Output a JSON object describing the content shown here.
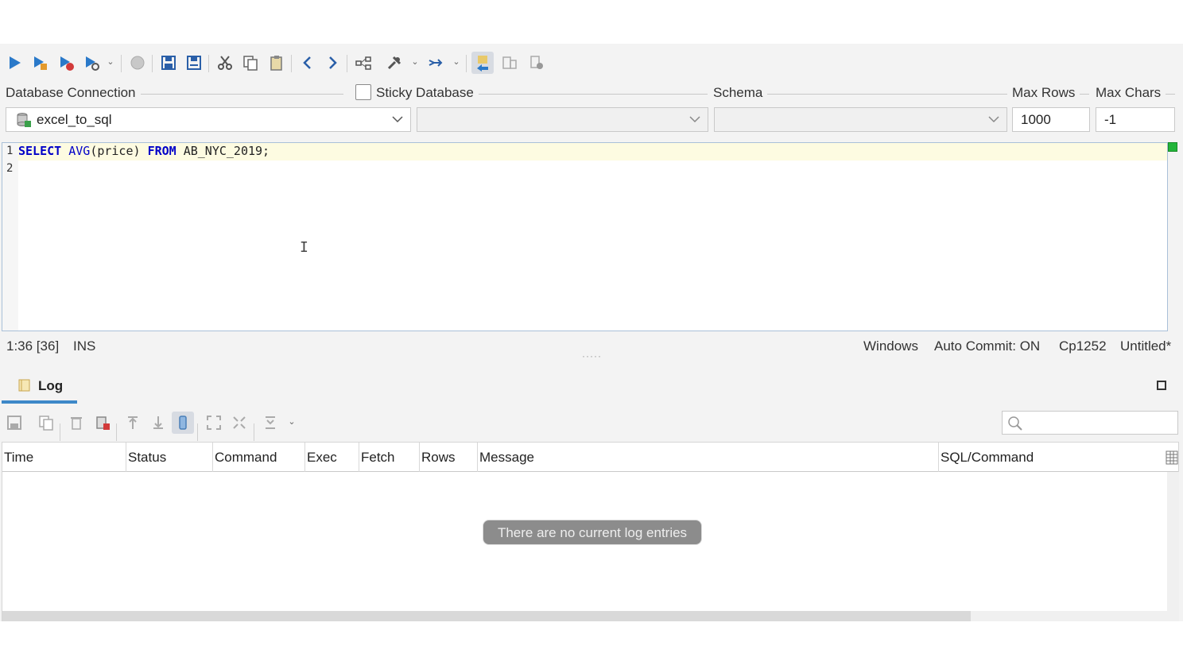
{
  "toolbar": {
    "buttons": [
      {
        "name": "execute-icon"
      },
      {
        "name": "execute-current-icon"
      },
      {
        "name": "execute-stop-on-error-icon"
      },
      {
        "name": "execute-explain-icon"
      },
      {
        "name": "stop-icon"
      },
      {
        "name": "save-icon"
      },
      {
        "name": "save-as-icon"
      },
      {
        "name": "cut-icon"
      },
      {
        "name": "copy-icon"
      },
      {
        "name": "paste-icon"
      },
      {
        "name": "back-icon"
      },
      {
        "name": "forward-icon"
      },
      {
        "name": "query-builder-icon"
      },
      {
        "name": "tools-icon"
      },
      {
        "name": "goto-icon"
      },
      {
        "name": "auto-complete-icon"
      },
      {
        "name": "format-icon"
      },
      {
        "name": "bookmark-icon"
      }
    ]
  },
  "connection": {
    "database_connection_label": "Database Connection",
    "sticky_database_label": "Sticky Database",
    "schema_label": "Schema",
    "max_rows_label": "Max Rows",
    "max_chars_label": "Max Chars",
    "connection_value": "excel_to_sql",
    "database_value": "",
    "schema_value": "",
    "max_rows_value": "1000",
    "max_chars_value": "-1",
    "sticky_checked": false
  },
  "editor": {
    "line_numbers": [
      "1",
      "2"
    ],
    "line1": {
      "kw1": "SELECT",
      "fn": "AVG",
      "args": "(price)",
      "kw2": "FROM",
      "rest": "AB_NYC_2019;"
    }
  },
  "status": {
    "position": "1:36 [36]",
    "mode": "INS",
    "line_endings": "Windows",
    "auto_commit": "Auto Commit: ON",
    "encoding": "Cp1252",
    "file": "Untitled*"
  },
  "log": {
    "tab_label": "Log",
    "search_placeholder": "",
    "columns": [
      "Time",
      "Status",
      "Command",
      "Exec",
      "Fetch",
      "Rows",
      "Message",
      "SQL/Command"
    ],
    "empty_message": "There are no current log entries"
  },
  "colors": {
    "keyword": "#0000c8",
    "accent": "#3d88c8",
    "current_line": "#fdfbe1",
    "marker": "#23b53a"
  }
}
